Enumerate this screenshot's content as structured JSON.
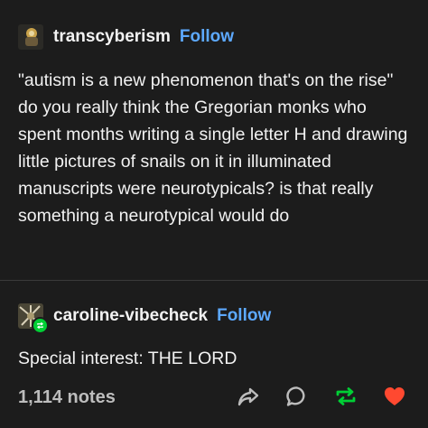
{
  "post_1": {
    "username": "transcyberism",
    "follow_label": "Follow",
    "text": "\"autism is a new phenomenon that's on the rise\" do you really think the Gregorian monks who spent months writing a single letter H and drawing little pictures of snails on it in illuminated manuscripts were neurotypicals? is that really something a neurotypical would do"
  },
  "post_2": {
    "username": "caroline-vibecheck",
    "follow_label": "Follow",
    "text": "Special interest: THE LORD"
  },
  "footer": {
    "notes": "1,114 notes",
    "icons": [
      "share-icon",
      "reply-icon",
      "reblog-icon",
      "like-icon"
    ]
  },
  "colors": {
    "background": "#1c1c1c",
    "follow": "#5da9ff",
    "reblog": "#00cf35",
    "like": "#ff4930"
  }
}
